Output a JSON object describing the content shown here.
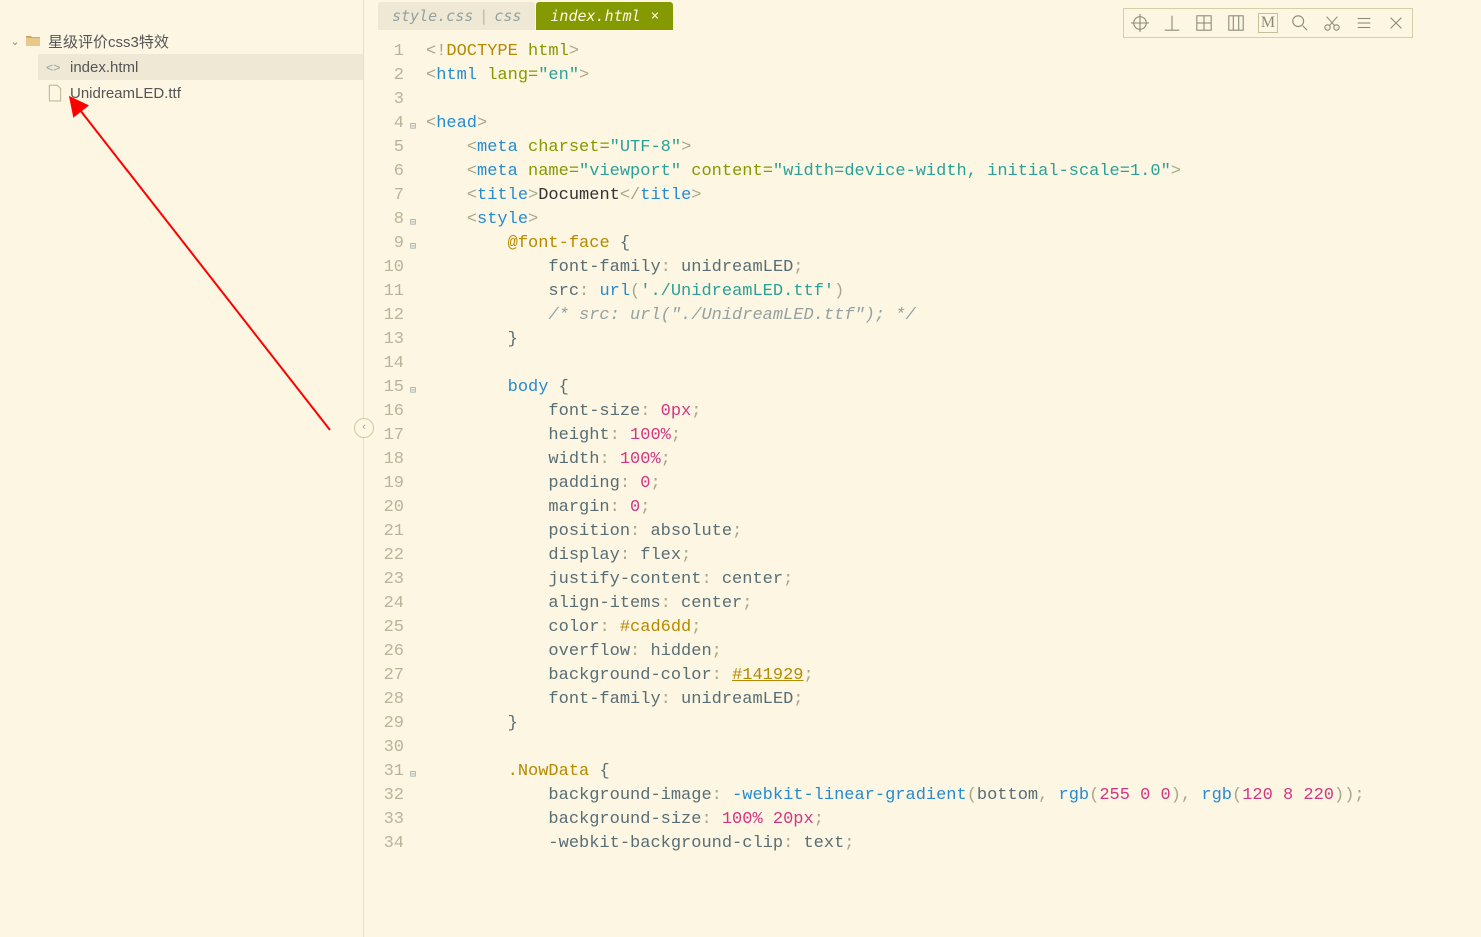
{
  "sidebar": {
    "folder": {
      "name": "星级评价css3特效"
    },
    "files": [
      {
        "name": "index.html",
        "kind": "html",
        "active": true
      },
      {
        "name": "UnidreamLED.ttf",
        "kind": "file",
        "active": false
      }
    ]
  },
  "tabs": [
    {
      "file": "style.css",
      "lang": "css",
      "active": false
    },
    {
      "file": "index.html",
      "lang": "",
      "active": true
    }
  ],
  "toolbar_icons": [
    "target",
    "perp",
    "grid4",
    "columns",
    "letter-m",
    "search",
    "scissors",
    "menu",
    "close"
  ],
  "code": {
    "lines": [
      {
        "n": 1,
        "fold": "",
        "tokens": [
          [
            "punct",
            "<!"
          ],
          [
            "doc",
            "DOCTYPE "
          ],
          [
            "attr",
            "html"
          ],
          [
            "punct",
            ">"
          ]
        ]
      },
      {
        "n": 2,
        "fold": "",
        "tokens": [
          [
            "punct",
            "<"
          ],
          [
            "tag",
            "html "
          ],
          [
            "attr",
            "lang="
          ],
          [
            "str",
            "\"en\""
          ],
          [
            "punct",
            ">"
          ]
        ]
      },
      {
        "n": 3,
        "fold": "",
        "tokens": []
      },
      {
        "n": 4,
        "fold": "⊟",
        "tokens": [
          [
            "punct",
            "<"
          ],
          [
            "tag",
            "head"
          ],
          [
            "punct",
            ">"
          ]
        ]
      },
      {
        "n": 5,
        "fold": "",
        "tokens": [
          [
            "ind",
            "    "
          ],
          [
            "punct",
            "<"
          ],
          [
            "tag",
            "meta "
          ],
          [
            "attr",
            "charset="
          ],
          [
            "str",
            "\"UTF-8\""
          ],
          [
            "punct",
            ">"
          ]
        ]
      },
      {
        "n": 6,
        "fold": "",
        "tokens": [
          [
            "ind",
            "    "
          ],
          [
            "punct",
            "<"
          ],
          [
            "tag",
            "meta "
          ],
          [
            "attr",
            "name="
          ],
          [
            "str",
            "\"viewport\""
          ],
          [
            "attr",
            " content="
          ],
          [
            "str",
            "\"width=device-width, initial-scale=1.0\""
          ],
          [
            "punct",
            ">"
          ]
        ]
      },
      {
        "n": 7,
        "fold": "",
        "tokens": [
          [
            "ind",
            "    "
          ],
          [
            "punct",
            "<"
          ],
          [
            "tag",
            "title"
          ],
          [
            "punct",
            ">"
          ],
          [
            "plain",
            "Document"
          ],
          [
            "punct",
            "</"
          ],
          [
            "tag",
            "title"
          ],
          [
            "punct",
            ">"
          ]
        ]
      },
      {
        "n": 8,
        "fold": "⊟",
        "tokens": [
          [
            "ind",
            "    "
          ],
          [
            "punct",
            "<"
          ],
          [
            "tag",
            "style"
          ],
          [
            "punct",
            ">"
          ]
        ]
      },
      {
        "n": 9,
        "fold": "⊟",
        "tokens": [
          [
            "ind",
            "        "
          ],
          [
            "kw",
            "@font-face"
          ],
          [
            "prop",
            " {"
          ]
        ]
      },
      {
        "n": 10,
        "fold": "",
        "tokens": [
          [
            "ind",
            "            "
          ],
          [
            "prop",
            "font-family"
          ],
          [
            "punct",
            ": "
          ],
          [
            "id",
            "unidreamLED"
          ],
          [
            "punct",
            ";"
          ]
        ]
      },
      {
        "n": 11,
        "fold": "",
        "tokens": [
          [
            "ind",
            "            "
          ],
          [
            "prop",
            "src"
          ],
          [
            "punct",
            ": "
          ],
          [
            "func",
            "url"
          ],
          [
            "punct",
            "("
          ],
          [
            "str",
            "'./UnidreamLED.ttf'"
          ],
          [
            "punct",
            ")"
          ]
        ]
      },
      {
        "n": 12,
        "fold": "",
        "tokens": [
          [
            "ind",
            "            "
          ],
          [
            "comment",
            "/* src: url(\"./UnidreamLED.ttf\"); */"
          ]
        ]
      },
      {
        "n": 13,
        "fold": "",
        "tokens": [
          [
            "ind",
            "        "
          ],
          [
            "prop",
            "}"
          ]
        ]
      },
      {
        "n": 14,
        "fold": "",
        "tokens": []
      },
      {
        "n": 15,
        "fold": "⊟",
        "tokens": [
          [
            "ind",
            "        "
          ],
          [
            "tag",
            "body"
          ],
          [
            "prop",
            " {"
          ]
        ]
      },
      {
        "n": 16,
        "fold": "",
        "tokens": [
          [
            "ind",
            "            "
          ],
          [
            "prop",
            "font-size"
          ],
          [
            "punct",
            ": "
          ],
          [
            "num",
            "0px"
          ],
          [
            "punct",
            ";"
          ]
        ]
      },
      {
        "n": 17,
        "fold": "",
        "tokens": [
          [
            "ind",
            "            "
          ],
          [
            "prop",
            "height"
          ],
          [
            "punct",
            ": "
          ],
          [
            "num",
            "100%"
          ],
          [
            "punct",
            ";"
          ]
        ]
      },
      {
        "n": 18,
        "fold": "",
        "tokens": [
          [
            "ind",
            "            "
          ],
          [
            "prop",
            "width"
          ],
          [
            "punct",
            ": "
          ],
          [
            "num",
            "100%"
          ],
          [
            "punct",
            ";"
          ]
        ]
      },
      {
        "n": 19,
        "fold": "",
        "tokens": [
          [
            "ind",
            "            "
          ],
          [
            "prop",
            "padding"
          ],
          [
            "punct",
            ": "
          ],
          [
            "num",
            "0"
          ],
          [
            "punct",
            ";"
          ]
        ]
      },
      {
        "n": 20,
        "fold": "",
        "tokens": [
          [
            "ind",
            "            "
          ],
          [
            "prop",
            "margin"
          ],
          [
            "punct",
            ": "
          ],
          [
            "num",
            "0"
          ],
          [
            "punct",
            ";"
          ]
        ]
      },
      {
        "n": 21,
        "fold": "",
        "tokens": [
          [
            "ind",
            "            "
          ],
          [
            "prop",
            "position"
          ],
          [
            "punct",
            ": "
          ],
          [
            "id",
            "absolute"
          ],
          [
            "punct",
            ";"
          ]
        ]
      },
      {
        "n": 22,
        "fold": "",
        "tokens": [
          [
            "ind",
            "            "
          ],
          [
            "prop",
            "display"
          ],
          [
            "punct",
            ": "
          ],
          [
            "id",
            "flex"
          ],
          [
            "punct",
            ";"
          ]
        ]
      },
      {
        "n": 23,
        "fold": "",
        "tokens": [
          [
            "ind",
            "            "
          ],
          [
            "prop",
            "justify-content"
          ],
          [
            "punct",
            ": "
          ],
          [
            "id",
            "center"
          ],
          [
            "punct",
            ";"
          ]
        ]
      },
      {
        "n": 24,
        "fold": "",
        "tokens": [
          [
            "ind",
            "            "
          ],
          [
            "prop",
            "align-items"
          ],
          [
            "punct",
            ": "
          ],
          [
            "id",
            "center"
          ],
          [
            "punct",
            ";"
          ]
        ]
      },
      {
        "n": 25,
        "fold": "",
        "tokens": [
          [
            "ind",
            "            "
          ],
          [
            "prop",
            "color"
          ],
          [
            "punct",
            ": "
          ],
          [
            "color",
            "#cad6dd"
          ],
          [
            "punct",
            ";"
          ]
        ]
      },
      {
        "n": 26,
        "fold": "",
        "tokens": [
          [
            "ind",
            "            "
          ],
          [
            "prop",
            "overflow"
          ],
          [
            "punct",
            ": "
          ],
          [
            "id",
            "hidden"
          ],
          [
            "punct",
            ";"
          ]
        ]
      },
      {
        "n": 27,
        "fold": "",
        "tokens": [
          [
            "ind",
            "            "
          ],
          [
            "prop",
            "background-color"
          ],
          [
            "punct",
            ": "
          ],
          [
            "colorU",
            "#141929"
          ],
          [
            "punct",
            ";"
          ]
        ]
      },
      {
        "n": 28,
        "fold": "",
        "tokens": [
          [
            "ind",
            "            "
          ],
          [
            "prop",
            "font-family"
          ],
          [
            "punct",
            ": "
          ],
          [
            "id",
            "unidreamLED"
          ],
          [
            "punct",
            ";"
          ]
        ]
      },
      {
        "n": 29,
        "fold": "",
        "tokens": [
          [
            "ind",
            "        "
          ],
          [
            "prop",
            "}"
          ]
        ]
      },
      {
        "n": 30,
        "fold": "",
        "tokens": []
      },
      {
        "n": 31,
        "fold": "⊟",
        "tokens": [
          [
            "ind",
            "        "
          ],
          [
            "class",
            ".NowData"
          ],
          [
            "prop",
            " {"
          ]
        ]
      },
      {
        "n": 32,
        "fold": "",
        "tokens": [
          [
            "ind",
            "            "
          ],
          [
            "prop",
            "background-image"
          ],
          [
            "punct",
            ": "
          ],
          [
            "func",
            "-webkit-linear-gradient"
          ],
          [
            "punct",
            "("
          ],
          [
            "id",
            "bottom"
          ],
          [
            "punct",
            ", "
          ],
          [
            "func",
            "rgb"
          ],
          [
            "punct",
            "("
          ],
          [
            "num",
            "255 0 0"
          ],
          [
            "punct",
            "), "
          ],
          [
            "func",
            "rgb"
          ],
          [
            "punct",
            "("
          ],
          [
            "num",
            "120 8 220"
          ],
          [
            "punct",
            "));"
          ]
        ]
      },
      {
        "n": 33,
        "fold": "",
        "tokens": [
          [
            "ind",
            "            "
          ],
          [
            "prop",
            "background-size"
          ],
          [
            "punct",
            ": "
          ],
          [
            "num",
            "100% 20px"
          ],
          [
            "punct",
            ";"
          ]
        ]
      },
      {
        "n": 34,
        "fold": "",
        "tokens": [
          [
            "ind",
            "            "
          ],
          [
            "prop",
            "-webkit-background-clip"
          ],
          [
            "punct",
            ": "
          ],
          [
            "id",
            "text"
          ],
          [
            "punct",
            ";"
          ]
        ]
      }
    ]
  }
}
